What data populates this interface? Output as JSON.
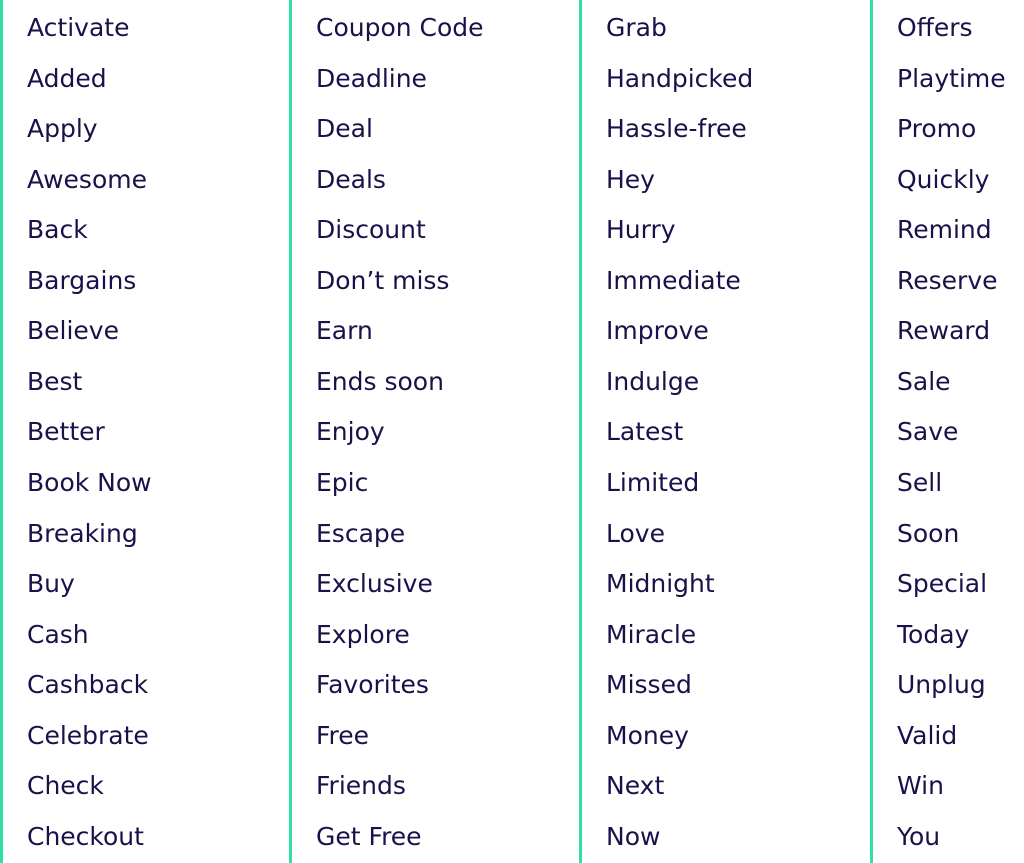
{
  "colors": {
    "divider": "#2fe0a6",
    "text": "#1b1049"
  },
  "columns": [
    [
      "Activate",
      "Added",
      "Apply",
      "Awesome",
      "Back",
      "Bargains",
      "Believe",
      "Best",
      "Better",
      "Book Now",
      "Breaking",
      "Buy",
      "Cash",
      "Cashback",
      "Celebrate",
      "Check",
      "Checkout"
    ],
    [
      "Coupon Code",
      "Deadline",
      "Deal",
      "Deals",
      "Discount",
      "Don’t miss",
      "Earn",
      "Ends soon",
      "Enjoy",
      "Epic",
      "Escape",
      "Exclusive",
      "Explore",
      "Favorites",
      "Free",
      "Friends",
      "Get Free"
    ],
    [
      "Grab",
      "Handpicked",
      "Hassle-free",
      "Hey",
      "Hurry",
      "Immediate",
      "Improve",
      "Indulge",
      "Latest",
      "Limited",
      "Love",
      "Midnight",
      "Miracle",
      "Missed",
      "Money",
      "Next",
      "Now"
    ],
    [
      "Offers",
      "Playtime",
      "Promo",
      "Quickly",
      "Remind",
      "Reserve",
      "Reward",
      "Sale",
      "Save",
      "Sell",
      "Soon",
      "Special",
      "Today",
      "Unplug",
      "Valid",
      "Win",
      "You"
    ]
  ]
}
